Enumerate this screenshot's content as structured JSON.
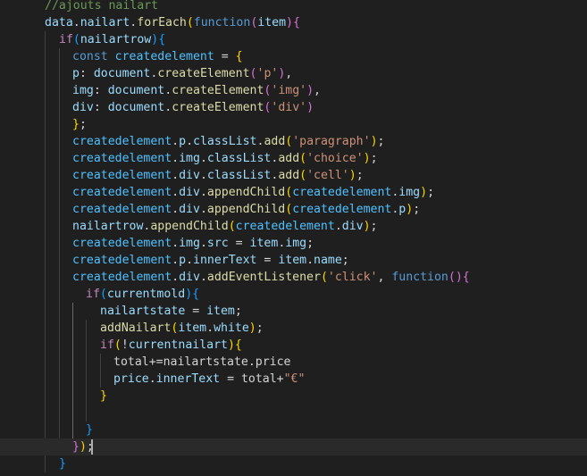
{
  "editor": {
    "language": "javascript",
    "theme_colors": {
      "background": "#1f1f1f",
      "current_line": "#2a2a2a",
      "comment": "#6a9955",
      "variable": "#9cdcfe",
      "function": "#dcdcaa",
      "keyword": "#569cd6",
      "control": "#c586c0",
      "string": "#ce9178",
      "constant": "#4fc1ff",
      "bracket_gold": "#ffd700",
      "bracket_orchid": "#da70d6",
      "bracket_blue": "#179fff"
    },
    "lines": [
      {
        "tokens": [
          {
            "t": "//ajouts nailart",
            "c": "comment"
          }
        ]
      },
      {
        "tokens": [
          {
            "t": "data",
            "c": "var"
          },
          {
            "t": ".",
            "c": "punc"
          },
          {
            "t": "nailart",
            "c": "var"
          },
          {
            "t": ".",
            "c": "punc"
          },
          {
            "t": "forEach",
            "c": "func"
          },
          {
            "t": "(",
            "c": "b1"
          },
          {
            "t": "function",
            "c": "kw"
          },
          {
            "t": "(",
            "c": "b2"
          },
          {
            "t": "item",
            "c": "var"
          },
          {
            "t": ")",
            "c": "b2"
          },
          {
            "t": "{",
            "c": "b2"
          }
        ]
      },
      {
        "tokens": [
          {
            "t": "if",
            "c": "ctrl"
          },
          {
            "t": "(",
            "c": "b3"
          },
          {
            "t": "nailartrow",
            "c": "var"
          },
          {
            "t": ")",
            "c": "b3"
          },
          {
            "t": "{",
            "c": "b3"
          }
        ]
      },
      {
        "tokens": [
          {
            "t": "const ",
            "c": "kw"
          },
          {
            "t": "createdelement",
            "c": "const"
          },
          {
            "t": " = ",
            "c": "punc"
          },
          {
            "t": "{",
            "c": "b1"
          }
        ]
      },
      {
        "tokens": [
          {
            "t": "p",
            "c": "var"
          },
          {
            "t": ": ",
            "c": "punc"
          },
          {
            "t": "document",
            "c": "var"
          },
          {
            "t": ".",
            "c": "punc"
          },
          {
            "t": "createElement",
            "c": "func"
          },
          {
            "t": "(",
            "c": "b2"
          },
          {
            "t": "'p'",
            "c": "str"
          },
          {
            "t": ")",
            "c": "b2"
          },
          {
            "t": ",",
            "c": "punc"
          }
        ]
      },
      {
        "tokens": [
          {
            "t": "img",
            "c": "var"
          },
          {
            "t": ": ",
            "c": "punc"
          },
          {
            "t": "document",
            "c": "var"
          },
          {
            "t": ".",
            "c": "punc"
          },
          {
            "t": "createElement",
            "c": "func"
          },
          {
            "t": "(",
            "c": "b2"
          },
          {
            "t": "'img'",
            "c": "str"
          },
          {
            "t": ")",
            "c": "b2"
          },
          {
            "t": ",",
            "c": "punc"
          }
        ]
      },
      {
        "tokens": [
          {
            "t": "div",
            "c": "var"
          },
          {
            "t": ": ",
            "c": "punc"
          },
          {
            "t": "document",
            "c": "var"
          },
          {
            "t": ".",
            "c": "punc"
          },
          {
            "t": "createElement",
            "c": "func"
          },
          {
            "t": "(",
            "c": "b2"
          },
          {
            "t": "'div'",
            "c": "str"
          },
          {
            "t": ")",
            "c": "b2"
          }
        ]
      },
      {
        "tokens": [
          {
            "t": "}",
            "c": "b1"
          },
          {
            "t": ";",
            "c": "punc"
          }
        ]
      },
      {
        "tokens": [
          {
            "t": "createdelement",
            "c": "const"
          },
          {
            "t": ".",
            "c": "punc"
          },
          {
            "t": "p",
            "c": "var"
          },
          {
            "t": ".",
            "c": "punc"
          },
          {
            "t": "classList",
            "c": "var"
          },
          {
            "t": ".",
            "c": "punc"
          },
          {
            "t": "add",
            "c": "func"
          },
          {
            "t": "(",
            "c": "b1"
          },
          {
            "t": "'paragraph'",
            "c": "str"
          },
          {
            "t": ")",
            "c": "b1"
          },
          {
            "t": ";",
            "c": "punc"
          }
        ]
      },
      {
        "tokens": [
          {
            "t": "createdelement",
            "c": "const"
          },
          {
            "t": ".",
            "c": "punc"
          },
          {
            "t": "img",
            "c": "var"
          },
          {
            "t": ".",
            "c": "punc"
          },
          {
            "t": "classList",
            "c": "var"
          },
          {
            "t": ".",
            "c": "punc"
          },
          {
            "t": "add",
            "c": "func"
          },
          {
            "t": "(",
            "c": "b1"
          },
          {
            "t": "'choice'",
            "c": "str"
          },
          {
            "t": ")",
            "c": "b1"
          },
          {
            "t": ";",
            "c": "punc"
          }
        ]
      },
      {
        "tokens": [
          {
            "t": "createdelement",
            "c": "const"
          },
          {
            "t": ".",
            "c": "punc"
          },
          {
            "t": "div",
            "c": "var"
          },
          {
            "t": ".",
            "c": "punc"
          },
          {
            "t": "classList",
            "c": "var"
          },
          {
            "t": ".",
            "c": "punc"
          },
          {
            "t": "add",
            "c": "func"
          },
          {
            "t": "(",
            "c": "b1"
          },
          {
            "t": "'cell'",
            "c": "str"
          },
          {
            "t": ")",
            "c": "b1"
          },
          {
            "t": ";",
            "c": "punc"
          }
        ]
      },
      {
        "tokens": [
          {
            "t": "createdelement",
            "c": "const"
          },
          {
            "t": ".",
            "c": "punc"
          },
          {
            "t": "div",
            "c": "var"
          },
          {
            "t": ".",
            "c": "punc"
          },
          {
            "t": "appendChild",
            "c": "func"
          },
          {
            "t": "(",
            "c": "b1"
          },
          {
            "t": "createdelement",
            "c": "const"
          },
          {
            "t": ".",
            "c": "punc"
          },
          {
            "t": "img",
            "c": "var"
          },
          {
            "t": ")",
            "c": "b1"
          },
          {
            "t": ";",
            "c": "punc"
          }
        ]
      },
      {
        "tokens": [
          {
            "t": "createdelement",
            "c": "const"
          },
          {
            "t": ".",
            "c": "punc"
          },
          {
            "t": "div",
            "c": "var"
          },
          {
            "t": ".",
            "c": "punc"
          },
          {
            "t": "appendChild",
            "c": "func"
          },
          {
            "t": "(",
            "c": "b1"
          },
          {
            "t": "createdelement",
            "c": "const"
          },
          {
            "t": ".",
            "c": "punc"
          },
          {
            "t": "p",
            "c": "var"
          },
          {
            "t": ")",
            "c": "b1"
          },
          {
            "t": ";",
            "c": "punc"
          }
        ]
      },
      {
        "tokens": [
          {
            "t": "nailartrow",
            "c": "var"
          },
          {
            "t": ".",
            "c": "punc"
          },
          {
            "t": "appendChild",
            "c": "func"
          },
          {
            "t": "(",
            "c": "b1"
          },
          {
            "t": "createdelement",
            "c": "const"
          },
          {
            "t": ".",
            "c": "punc"
          },
          {
            "t": "div",
            "c": "var"
          },
          {
            "t": ")",
            "c": "b1"
          },
          {
            "t": ";",
            "c": "punc"
          }
        ]
      },
      {
        "tokens": [
          {
            "t": "createdelement",
            "c": "const"
          },
          {
            "t": ".",
            "c": "punc"
          },
          {
            "t": "img",
            "c": "var"
          },
          {
            "t": ".",
            "c": "punc"
          },
          {
            "t": "src",
            "c": "var"
          },
          {
            "t": " = ",
            "c": "punc"
          },
          {
            "t": "item",
            "c": "var"
          },
          {
            "t": ".",
            "c": "punc"
          },
          {
            "t": "img",
            "c": "var"
          },
          {
            "t": ";",
            "c": "punc"
          }
        ]
      },
      {
        "tokens": [
          {
            "t": "createdelement",
            "c": "const"
          },
          {
            "t": ".",
            "c": "punc"
          },
          {
            "t": "p",
            "c": "var"
          },
          {
            "t": ".",
            "c": "punc"
          },
          {
            "t": "innerText",
            "c": "var"
          },
          {
            "t": " = ",
            "c": "punc"
          },
          {
            "t": "item",
            "c": "var"
          },
          {
            "t": ".",
            "c": "punc"
          },
          {
            "t": "name",
            "c": "var"
          },
          {
            "t": ";",
            "c": "punc"
          }
        ]
      },
      {
        "tokens": [
          {
            "t": "createdelement",
            "c": "const"
          },
          {
            "t": ".",
            "c": "punc"
          },
          {
            "t": "div",
            "c": "var"
          },
          {
            "t": ".",
            "c": "punc"
          },
          {
            "t": "addEventListener",
            "c": "func"
          },
          {
            "t": "(",
            "c": "b1"
          },
          {
            "t": "'click'",
            "c": "str"
          },
          {
            "t": ", ",
            "c": "punc"
          },
          {
            "t": "function",
            "c": "kw"
          },
          {
            "t": "(",
            "c": "b2"
          },
          {
            "t": ")",
            "c": "b2"
          },
          {
            "t": "{",
            "c": "b2"
          }
        ]
      },
      {
        "tokens": [
          {
            "t": "if",
            "c": "ctrl"
          },
          {
            "t": "(",
            "c": "b3"
          },
          {
            "t": "currentmold",
            "c": "var"
          },
          {
            "t": ")",
            "c": "b3"
          },
          {
            "t": "{",
            "c": "b3"
          }
        ]
      },
      {
        "tokens": [
          {
            "t": "nailartstate",
            "c": "var"
          },
          {
            "t": " = ",
            "c": "punc"
          },
          {
            "t": "item",
            "c": "var"
          },
          {
            "t": ";",
            "c": "punc"
          }
        ]
      },
      {
        "tokens": [
          {
            "t": "addNailart",
            "c": "func"
          },
          {
            "t": "(",
            "c": "b1"
          },
          {
            "t": "item",
            "c": "var"
          },
          {
            "t": ".",
            "c": "punc"
          },
          {
            "t": "white",
            "c": "var"
          },
          {
            "t": ")",
            "c": "b1"
          },
          {
            "t": ";",
            "c": "punc"
          }
        ]
      },
      {
        "tokens": [
          {
            "t": "if",
            "c": "ctrl"
          },
          {
            "t": "(",
            "c": "b1"
          },
          {
            "t": "!",
            "c": "punc"
          },
          {
            "t": "currentnailart",
            "c": "var"
          },
          {
            "t": ")",
            "c": "b1"
          },
          {
            "t": "{",
            "c": "b1"
          }
        ]
      },
      {
        "tokens": [
          {
            "t": "total+=nailartstate.price",
            "c": "punc"
          }
        ]
      },
      {
        "tokens": [
          {
            "t": "price",
            "c": "var"
          },
          {
            "t": ".",
            "c": "punc"
          },
          {
            "t": "innerText",
            "c": "var"
          },
          {
            "t": " = total+",
            "c": "punc"
          },
          {
            "t": "\"€\"",
            "c": "str"
          }
        ]
      },
      {
        "tokens": [
          {
            "t": "}",
            "c": "b1"
          }
        ]
      },
      {
        "tokens": []
      },
      {
        "tokens": [
          {
            "t": "}",
            "c": "b3"
          }
        ]
      },
      {
        "tokens": [
          {
            "t": "}",
            "c": "b2"
          },
          {
            "t": ")",
            "c": "b1"
          },
          {
            "t": ";",
            "c": "punc"
          }
        ]
      },
      {
        "tokens": [
          {
            "t": "}",
            "c": "b3"
          }
        ]
      }
    ]
  }
}
